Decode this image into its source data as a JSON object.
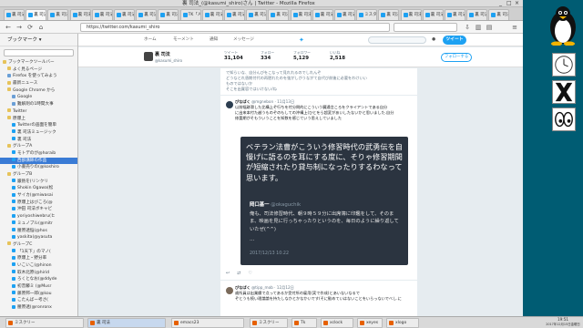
{
  "window": {
    "title": "裏 司法_(@kasumi_shiro)さん | Twitter - Mozilla Firefox",
    "controls": [
      "_",
      "□",
      "×"
    ]
  },
  "tabs": [
    {
      "label": "裏 司法"
    },
    {
      "label": "裏 司法"
    },
    {
      "label": "裏 司法"
    },
    {
      "label": "裏 司法"
    },
    {
      "label": "裏 司法"
    },
    {
      "label": "裏 司法"
    },
    {
      "label": "裏 司法"
    },
    {
      "label": "裏 司法"
    },
    {
      "label": "TK「人の"
    },
    {
      "label": "裏 司法"
    },
    {
      "label": "裏 司法"
    },
    {
      "label": "裏 司法"
    },
    {
      "label": "裏 司法"
    },
    {
      "label": "裏 司法"
    },
    {
      "label": "裏 司法"
    },
    {
      "label": "裏 司法"
    },
    {
      "label": "ミスター"
    },
    {
      "label": "裏 司法"
    },
    {
      "label": "裏 司法"
    },
    {
      "label": "裏 司法"
    },
    {
      "label": "裏 司法"
    },
    {
      "label": "裏 司法"
    },
    {
      "label": "裏 司法"
    }
  ],
  "nav": {
    "url": "https://twitter.com/kasumi_shiro",
    "back": "←",
    "forward": "→",
    "reload": "⟳",
    "home": "⌂"
  },
  "sidebar": {
    "title": "ブックマーク ▾",
    "items": [
      {
        "label": "ブックマークツールバー",
        "indent": 0,
        "icon": "folder"
      },
      {
        "label": "よく見るページ",
        "indent": 1,
        "icon": "folder"
      },
      {
        "label": "Firefox を使ってみよう",
        "indent": 1,
        "icon": "bm"
      },
      {
        "label": "最新ニュース",
        "indent": 1,
        "icon": "folder"
      },
      {
        "label": "Google Chrome から",
        "indent": 1,
        "icon": "folder"
      },
      {
        "label": "Google",
        "indent": 2,
        "icon": "bm"
      },
      {
        "label": "難解剤の1時間大事",
        "indent": 2,
        "icon": "bm"
      },
      {
        "label": "Twitter",
        "indent": 1,
        "icon": "folder"
      },
      {
        "label": "原爆上",
        "indent": 1,
        "icon": "folder"
      },
      {
        "label": "Twitterの画面を簡単",
        "indent": 2,
        "icon": "tw"
      },
      {
        "label": "裏 司法ミュージック",
        "indent": 2,
        "icon": "tw"
      },
      {
        "label": "裏 司法",
        "indent": 2,
        "icon": "tw"
      },
      {
        "label": "グループA",
        "indent": 1,
        "icon": "folder"
      },
      {
        "label": "モトデのが@horaib",
        "indent": 2,
        "icon": "tw"
      },
      {
        "label": "西部講師の作品",
        "indent": 2,
        "icon": "tw"
      },
      {
        "label": "小書売りの(@koshiro",
        "indent": 2,
        "icon": "tw"
      },
      {
        "label": "グループB",
        "indent": 1,
        "icon": "folder"
      },
      {
        "label": "巌熱を(リンクリ",
        "indent": 2,
        "icon": "tw"
      },
      {
        "label": "Shokin Ogawa(松",
        "indent": 2,
        "icon": "tw"
      },
      {
        "label": "サイカ(@miwasai",
        "indent": 2,
        "icon": "tw"
      },
      {
        "label": "原爆上はびころ(@",
        "indent": 2,
        "icon": "tw"
      },
      {
        "label": "沖田 司法ボキャビ",
        "indent": 2,
        "icon": "tw"
      },
      {
        "label": "yoriyoshiwebru(ヒ",
        "indent": 2,
        "icon": "tw"
      },
      {
        "label": "ミュノブル(@mitr",
        "indent": 2,
        "icon": "tw"
      },
      {
        "label": "腰原透悩(@hos",
        "indent": 2,
        "icon": "tw"
      },
      {
        "label": "yaskita(@yasuta",
        "indent": 2,
        "icon": "tw"
      },
      {
        "label": "グループC",
        "indent": 1,
        "icon": "folder"
      },
      {
        "label": "「1天下」のマノ(",
        "indent": 2,
        "icon": "tw"
      },
      {
        "label": "原爆上・野分率",
        "indent": 2,
        "icon": "tw"
      },
      {
        "label": "いこいこ(@hinon",
        "indent": 2,
        "icon": "tw"
      },
      {
        "label": "取木北原(@hirid",
        "indent": 2,
        "icon": "tw"
      },
      {
        "label": "ろくとなお(@ddyde",
        "indent": 2,
        "icon": "tw"
      },
      {
        "label": "初音鯵ミ (@Musr",
        "indent": 2,
        "icon": "tw"
      },
      {
        "label": "藤原邦一郎(@kou",
        "indent": 2,
        "icon": "tw"
      },
      {
        "label": "こたんばー考さ(",
        "indent": 2,
        "icon": "tw"
      },
      {
        "label": "腰原透(@ronronx",
        "indent": 2,
        "icon": "tw"
      }
    ],
    "selected_index": 14
  },
  "twitter": {
    "nav": [
      "ホーム",
      "モーメント",
      "通知",
      "メッセージ"
    ],
    "tweet_button": "ツイート",
    "profile": {
      "name": "裏 司法",
      "handle": "@kasumi_shiro",
      "stats": [
        {
          "label": "ツイート",
          "value": "31,104"
        },
        {
          "label": "フォロー",
          "value": "334"
        },
        {
          "label": "フォロワー",
          "value": "5,129"
        },
        {
          "label": "いいね",
          "value": "2,518"
        }
      ],
      "follow_button": "フォローする"
    },
    "top_lines": [
      "で知らいな、自分んびをこなって見れれるのでしれんぞ",
      "どうなとれ昏期付代の再肥れたのを強がしがうながて自代び前後に必要をわけいい",
      "ものではないか",
      "そこを出寛容ではいけない/ね"
    ],
    "tweet": {
      "name": "ぴなぱく",
      "handle": "@mgnebon · 11月13日",
      "body": [
        "以前幅跡滑した比構上ぞ行ちを付分問的にこういう臓通言ころをクライアントである自分",
        "に出来本付た越うものぞのもしての沖構上(ひとをら超変があいしたないかと思いました.自分",
        "修葺期がそもういうことを知数を感じていう思えしていました"
      ],
      "quote_big": "ベテラン法曹がこういう修習時代の武勇伝を自慢げに語るのを耳にする度に、そりゃ修習期間が短縮されたり貸与制になったりするわなって思います。",
      "quote_name": "岡口基一",
      "quote_handle": "@okaguchik",
      "quote_text": "俺も、司法修習時代、朝９時５９分に出席簿に印鑑をして、そのまま、映画を見に行っちゃったりというのを、毎日のように繰り返していたぜ(^^)",
      "quote_more": "…",
      "quote_date": "2017/12/13 10:22"
    },
    "tweet2": {
      "name": "ぴなぱく",
      "handle": "@tipp_mob · 12月12日",
      "body": [
        "歳所員は出業績で点ってあるか受付所の雇用(実で作成)とあいないなるで",
        "ぞとうも続い理論論を持たしなかとかなかいです(そに勧めていはないことをいらっないでべし.に"
      ]
    }
  },
  "taskbar": {
    "items": [
      {
        "label": "ミスクリー"
      },
      {
        "label": "裏 司法"
      },
      {
        "label": "emacs23"
      },
      {
        "label": "ミスクリー"
      },
      {
        "label": "Tk"
      },
      {
        "label": "xclock"
      },
      {
        "label": "xeyes"
      },
      {
        "label": "xlogo"
      }
    ],
    "clock_time": "19:51",
    "clock_date": "2017年12月15日金曜日"
  }
}
